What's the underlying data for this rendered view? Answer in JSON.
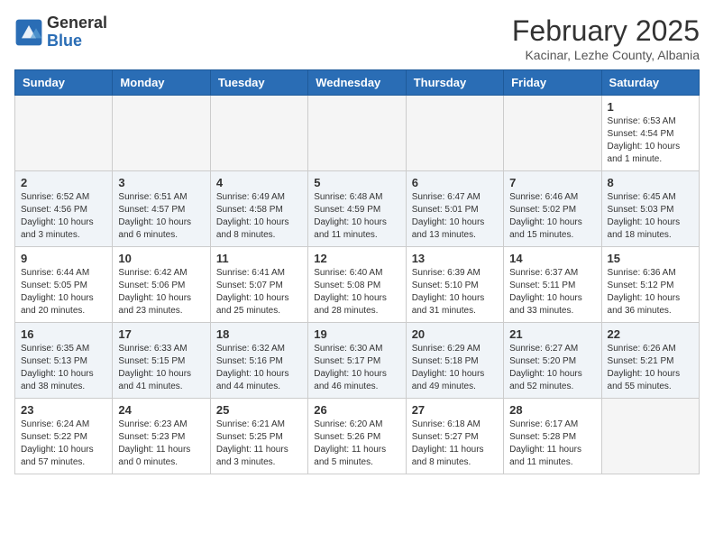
{
  "header": {
    "logo_general": "General",
    "logo_blue": "Blue",
    "month_title": "February 2025",
    "location": "Kacinar, Lezhe County, Albania"
  },
  "days_of_week": [
    "Sunday",
    "Monday",
    "Tuesday",
    "Wednesday",
    "Thursday",
    "Friday",
    "Saturday"
  ],
  "weeks": [
    [
      {
        "day": "",
        "info": ""
      },
      {
        "day": "",
        "info": ""
      },
      {
        "day": "",
        "info": ""
      },
      {
        "day": "",
        "info": ""
      },
      {
        "day": "",
        "info": ""
      },
      {
        "day": "",
        "info": ""
      },
      {
        "day": "1",
        "info": "Sunrise: 6:53 AM\nSunset: 4:54 PM\nDaylight: 10 hours\nand 1 minute."
      }
    ],
    [
      {
        "day": "2",
        "info": "Sunrise: 6:52 AM\nSunset: 4:56 PM\nDaylight: 10 hours\nand 3 minutes."
      },
      {
        "day": "3",
        "info": "Sunrise: 6:51 AM\nSunset: 4:57 PM\nDaylight: 10 hours\nand 6 minutes."
      },
      {
        "day": "4",
        "info": "Sunrise: 6:49 AM\nSunset: 4:58 PM\nDaylight: 10 hours\nand 8 minutes."
      },
      {
        "day": "5",
        "info": "Sunrise: 6:48 AM\nSunset: 4:59 PM\nDaylight: 10 hours\nand 11 minutes."
      },
      {
        "day": "6",
        "info": "Sunrise: 6:47 AM\nSunset: 5:01 PM\nDaylight: 10 hours\nand 13 minutes."
      },
      {
        "day": "7",
        "info": "Sunrise: 6:46 AM\nSunset: 5:02 PM\nDaylight: 10 hours\nand 15 minutes."
      },
      {
        "day": "8",
        "info": "Sunrise: 6:45 AM\nSunset: 5:03 PM\nDaylight: 10 hours\nand 18 minutes."
      }
    ],
    [
      {
        "day": "9",
        "info": "Sunrise: 6:44 AM\nSunset: 5:05 PM\nDaylight: 10 hours\nand 20 minutes."
      },
      {
        "day": "10",
        "info": "Sunrise: 6:42 AM\nSunset: 5:06 PM\nDaylight: 10 hours\nand 23 minutes."
      },
      {
        "day": "11",
        "info": "Sunrise: 6:41 AM\nSunset: 5:07 PM\nDaylight: 10 hours\nand 25 minutes."
      },
      {
        "day": "12",
        "info": "Sunrise: 6:40 AM\nSunset: 5:08 PM\nDaylight: 10 hours\nand 28 minutes."
      },
      {
        "day": "13",
        "info": "Sunrise: 6:39 AM\nSunset: 5:10 PM\nDaylight: 10 hours\nand 31 minutes."
      },
      {
        "day": "14",
        "info": "Sunrise: 6:37 AM\nSunset: 5:11 PM\nDaylight: 10 hours\nand 33 minutes."
      },
      {
        "day": "15",
        "info": "Sunrise: 6:36 AM\nSunset: 5:12 PM\nDaylight: 10 hours\nand 36 minutes."
      }
    ],
    [
      {
        "day": "16",
        "info": "Sunrise: 6:35 AM\nSunset: 5:13 PM\nDaylight: 10 hours\nand 38 minutes."
      },
      {
        "day": "17",
        "info": "Sunrise: 6:33 AM\nSunset: 5:15 PM\nDaylight: 10 hours\nand 41 minutes."
      },
      {
        "day": "18",
        "info": "Sunrise: 6:32 AM\nSunset: 5:16 PM\nDaylight: 10 hours\nand 44 minutes."
      },
      {
        "day": "19",
        "info": "Sunrise: 6:30 AM\nSunset: 5:17 PM\nDaylight: 10 hours\nand 46 minutes."
      },
      {
        "day": "20",
        "info": "Sunrise: 6:29 AM\nSunset: 5:18 PM\nDaylight: 10 hours\nand 49 minutes."
      },
      {
        "day": "21",
        "info": "Sunrise: 6:27 AM\nSunset: 5:20 PM\nDaylight: 10 hours\nand 52 minutes."
      },
      {
        "day": "22",
        "info": "Sunrise: 6:26 AM\nSunset: 5:21 PM\nDaylight: 10 hours\nand 55 minutes."
      }
    ],
    [
      {
        "day": "23",
        "info": "Sunrise: 6:24 AM\nSunset: 5:22 PM\nDaylight: 10 hours\nand 57 minutes."
      },
      {
        "day": "24",
        "info": "Sunrise: 6:23 AM\nSunset: 5:23 PM\nDaylight: 11 hours\nand 0 minutes."
      },
      {
        "day": "25",
        "info": "Sunrise: 6:21 AM\nSunset: 5:25 PM\nDaylight: 11 hours\nand 3 minutes."
      },
      {
        "day": "26",
        "info": "Sunrise: 6:20 AM\nSunset: 5:26 PM\nDaylight: 11 hours\nand 5 minutes."
      },
      {
        "day": "27",
        "info": "Sunrise: 6:18 AM\nSunset: 5:27 PM\nDaylight: 11 hours\nand 8 minutes."
      },
      {
        "day": "28",
        "info": "Sunrise: 6:17 AM\nSunset: 5:28 PM\nDaylight: 11 hours\nand 11 minutes."
      },
      {
        "day": "",
        "info": ""
      }
    ]
  ]
}
